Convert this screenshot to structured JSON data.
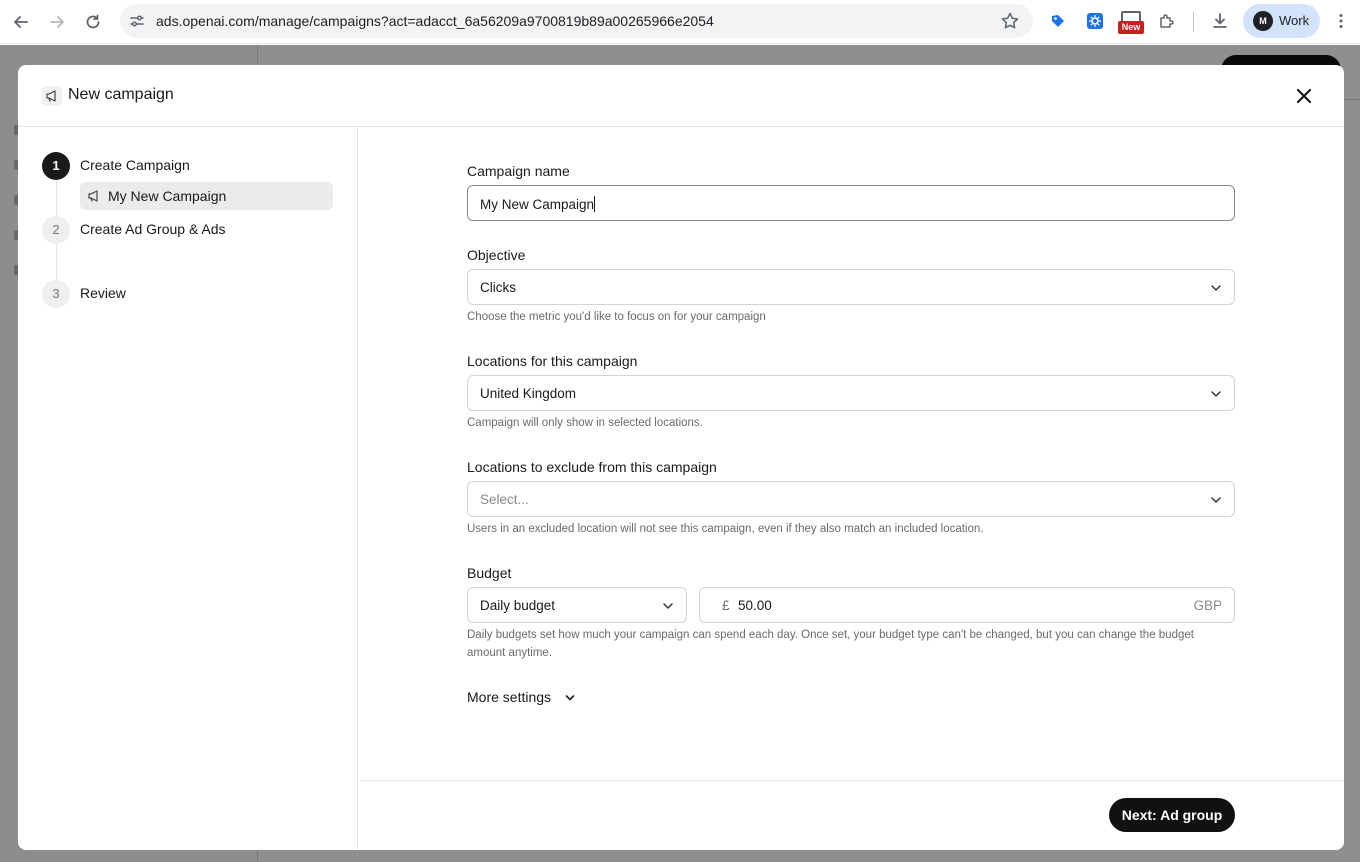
{
  "browser": {
    "url": "ads.openai.com/manage/campaigns?act=adacct_6a56209a9700819b89a00265966e2054",
    "badge_new": "New",
    "profile_label": "Work",
    "profile_initials": "M"
  },
  "modal": {
    "title": "New campaign",
    "steps": [
      {
        "number": "1",
        "label": "Create Campaign",
        "sub_item": "My New Campaign"
      },
      {
        "number": "2",
        "label": "Create Ad Group & Ads"
      },
      {
        "number": "3",
        "label": "Review"
      }
    ],
    "form": {
      "campaign_name": {
        "label": "Campaign name",
        "value": "My New Campaign"
      },
      "objective": {
        "label": "Objective",
        "value": "Clicks",
        "help": "Choose the metric you'd like to focus on for your campaign"
      },
      "locations": {
        "label": "Locations for this campaign",
        "value": "United Kingdom",
        "help": "Campaign will only show in selected locations."
      },
      "exclude_locations": {
        "label": "Locations to exclude from this campaign",
        "placeholder": "Select...",
        "help": "Users in an excluded location will not see this campaign, even if they also match an included location."
      },
      "budget": {
        "label": "Budget",
        "type": "Daily budget",
        "currency_symbol": "£",
        "amount": "50.00",
        "currency_code": "GBP",
        "help": "Daily budgets set how much your campaign can spend each day. Once set, your budget type can't be changed, but you can change the budget amount anytime."
      },
      "more_settings": "More settings"
    },
    "next_button": "Next: Ad group"
  },
  "colors": {
    "accent": "#111111",
    "backdrop": "#6b6b6b",
    "badge": "#c5221f"
  }
}
